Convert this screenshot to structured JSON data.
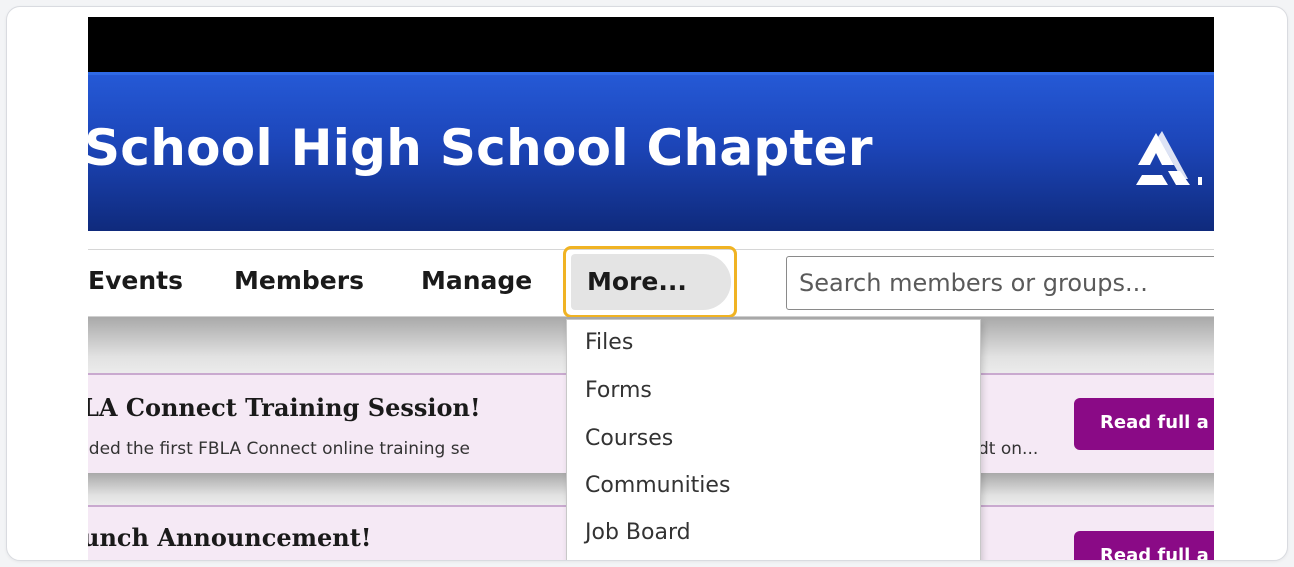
{
  "header": {
    "title": "School High School Chapter"
  },
  "nav": {
    "items": [
      "Events",
      "Members",
      "Manage"
    ],
    "more_label": "More..."
  },
  "search": {
    "placeholder": "Search members or groups..."
  },
  "dropdown": {
    "items": [
      "Files",
      "Forms",
      "Courses",
      "Communities",
      "Job Board"
    ]
  },
  "announcements": [
    {
      "title": "LA Connect Training Session!",
      "text": "nded the first FBLA Connect online training se",
      "text_right": "dt on...",
      "button": "Read full a"
    },
    {
      "title": "unch Announcement!",
      "button": "Read full a"
    }
  ],
  "colors": {
    "banner": "#1c45b8",
    "highlight": "#f0b323",
    "button": "#8a0a86",
    "card": "#f5e9f5"
  },
  "icons": {
    "logo": "fbla-triangle-logo-icon"
  }
}
